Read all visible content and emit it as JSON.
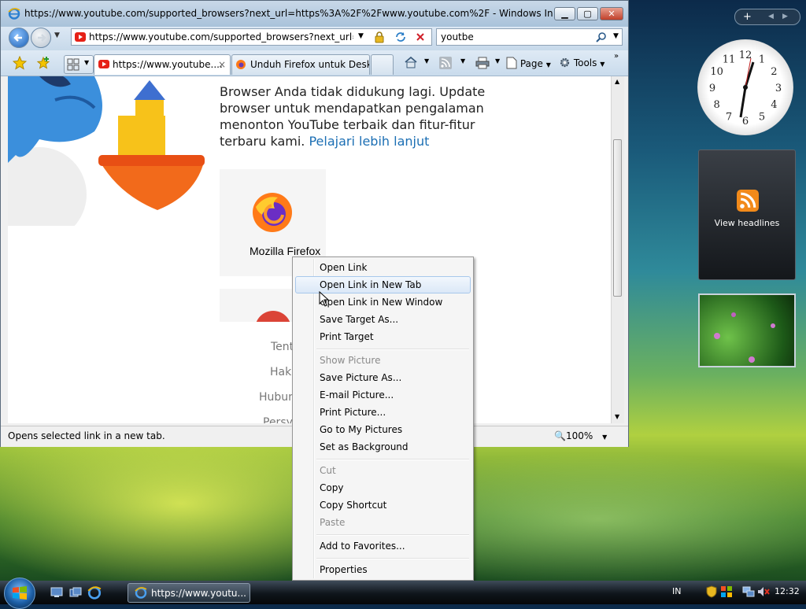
{
  "window": {
    "title": "https://www.youtube.com/supported_browsers?next_url=https%3A%2F%2Fwww.youtube.com%2F - Windows Internet Explo...",
    "address": "https://www.youtube.com/supported_browsers?next_url=https'",
    "search": "youtbe",
    "tabs": [
      {
        "label": "https://www.youtube...."
      },
      {
        "label": "Unduh Firefox untuk Desk..."
      }
    ],
    "toolbar": {
      "page": "Page",
      "tools": "Tools"
    },
    "status": "Opens selected link in a new tab.",
    "zoom": "100%"
  },
  "page": {
    "message": "Browser Anda tidak didukung lagi. Update browser untuk mendapatkan pengalaman menonton YouTube terbaik dan fitur-fitur terbaru kami.",
    "learn_more": "Pelajari lebih lanjut",
    "browser_name": "Mozilla Firefox",
    "footer": [
      "Tent",
      "Hak",
      "Hubun",
      "Persya"
    ]
  },
  "context_menu": {
    "items": [
      {
        "label": "Open Link",
        "disabled": false
      },
      {
        "label": "Open Link in New Tab",
        "disabled": false,
        "highlighted": true
      },
      {
        "label": "Open Link in New Window",
        "disabled": false
      },
      {
        "label": "Save Target As...",
        "disabled": false
      },
      {
        "label": "Print Target",
        "disabled": false
      },
      {
        "label": "Show Picture",
        "disabled": true
      },
      {
        "label": "Save Picture As...",
        "disabled": false
      },
      {
        "label": "E-mail Picture...",
        "disabled": false
      },
      {
        "label": "Print Picture...",
        "disabled": false
      },
      {
        "label": "Go to My Pictures",
        "disabled": false
      },
      {
        "label": "Set as Background",
        "disabled": false
      },
      {
        "label": "Cut",
        "disabled": true
      },
      {
        "label": "Copy",
        "disabled": false
      },
      {
        "label": "Copy Shortcut",
        "disabled": false
      },
      {
        "label": "Paste",
        "disabled": true
      },
      {
        "label": "Add to Favorites...",
        "disabled": false
      },
      {
        "label": "Properties",
        "disabled": false
      }
    ]
  },
  "sidebar": {
    "clock_numbers": [
      "12",
      "1",
      "2",
      "3",
      "4",
      "5",
      "6",
      "7",
      "8",
      "9",
      "10",
      "11"
    ],
    "feed_label": "View headlines"
  },
  "taskbar": {
    "task_label": "https://www.youtu...",
    "language": "IN",
    "time": "12:32"
  },
  "icons": [
    "ie-icon",
    "back-icon",
    "forward-icon",
    "lock-icon",
    "refresh-icon",
    "stop-icon",
    "search-icon",
    "favorites-star-icon",
    "add-favorites-icon",
    "quick-tabs-icon",
    "youtube-icon",
    "firefox-icon",
    "home-icon",
    "rss-icon",
    "print-icon",
    "page-icon",
    "tools-gear-icon",
    "close-icon",
    "windows-orb-icon"
  ]
}
